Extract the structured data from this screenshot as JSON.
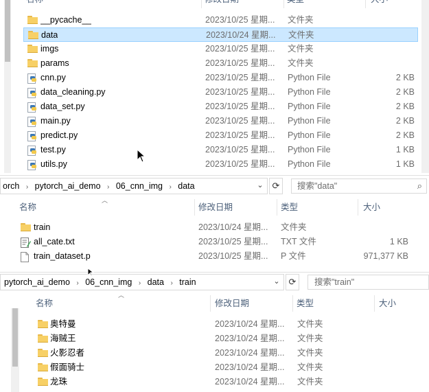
{
  "window1": {
    "columns": {
      "name": "名称",
      "date": "修改日期",
      "type": "类型",
      "size": "大小"
    },
    "rows": [
      {
        "name": "__pycache__",
        "date": "2023/10/25 星期...",
        "type": "文件夹",
        "size": "",
        "icon": "folder-icon",
        "selected": false
      },
      {
        "name": "data",
        "date": "2023/10/24 星期...",
        "type": "文件夹",
        "size": "",
        "icon": "folder-icon",
        "selected": true
      },
      {
        "name": "imgs",
        "date": "2023/10/25 星期...",
        "type": "文件夹",
        "size": "",
        "icon": "folder-icon",
        "selected": false
      },
      {
        "name": "params",
        "date": "2023/10/25 星期...",
        "type": "文件夹",
        "size": "",
        "icon": "folder-icon",
        "selected": false
      },
      {
        "name": "cnn.py",
        "date": "2023/10/25 星期...",
        "type": "Python File",
        "size": "2 KB",
        "icon": "python-file-icon",
        "selected": false
      },
      {
        "name": "data_cleaning.py",
        "date": "2023/10/25 星期...",
        "type": "Python File",
        "size": "2 KB",
        "icon": "python-file-icon",
        "selected": false
      },
      {
        "name": "data_set.py",
        "date": "2023/10/25 星期...",
        "type": "Python File",
        "size": "2 KB",
        "icon": "python-file-icon",
        "selected": false
      },
      {
        "name": "main.py",
        "date": "2023/10/25 星期...",
        "type": "Python File",
        "size": "2 KB",
        "icon": "python-file-icon",
        "selected": false
      },
      {
        "name": "predict.py",
        "date": "2023/10/25 星期...",
        "type": "Python File",
        "size": "2 KB",
        "icon": "python-file-icon",
        "selected": false
      },
      {
        "name": "test.py",
        "date": "2023/10/25 星期...",
        "type": "Python File",
        "size": "1 KB",
        "icon": "python-file-icon",
        "selected": false
      },
      {
        "name": "utils.py",
        "date": "2023/10/25 星期...",
        "type": "Python File",
        "size": "1 KB",
        "icon": "python-file-icon",
        "selected": false
      }
    ]
  },
  "window2": {
    "breadcrumb": [
      "orch",
      "pytorch_ai_demo",
      "06_cnn_img",
      "data"
    ],
    "search_placeholder": "搜索\"data\"",
    "columns": {
      "name": "名称",
      "date": "修改日期",
      "type": "类型",
      "size": "大小"
    },
    "rows": [
      {
        "name": "train",
        "date": "2023/10/24 星期...",
        "type": "文件夹",
        "size": "",
        "icon": "folder-icon"
      },
      {
        "name": "all_cate.txt",
        "date": "2023/10/25 星期...",
        "type": "TXT 文件",
        "size": "1 KB",
        "icon": "text-file-icon"
      },
      {
        "name": "train_dataset.p",
        "date": "2023/10/25 星期...",
        "type": "P 文件",
        "size": "971,377 KB",
        "icon": "file-icon"
      }
    ]
  },
  "window3": {
    "breadcrumb": [
      "pytorch_ai_demo",
      "06_cnn_img",
      "data",
      "train"
    ],
    "search_placeholder": "搜索\"train\"",
    "columns": {
      "name": "名称",
      "date": "修改日期",
      "type": "类型",
      "size": "大小"
    },
    "rows": [
      {
        "name": "奥特曼",
        "date": "2023/10/24 星期...",
        "type": "文件夹",
        "size": "",
        "icon": "folder-icon"
      },
      {
        "name": "海贼王",
        "date": "2023/10/24 星期...",
        "type": "文件夹",
        "size": "",
        "icon": "folder-icon"
      },
      {
        "name": "火影忍者",
        "date": "2023/10/24 星期...",
        "type": "文件夹",
        "size": "",
        "icon": "folder-icon"
      },
      {
        "name": "假面骑士",
        "date": "2023/10/24 星期...",
        "type": "文件夹",
        "size": "",
        "icon": "folder-icon"
      },
      {
        "name": "龙珠",
        "date": "2023/10/24 星期...",
        "type": "文件夹",
        "size": "",
        "icon": "folder-icon"
      }
    ]
  }
}
